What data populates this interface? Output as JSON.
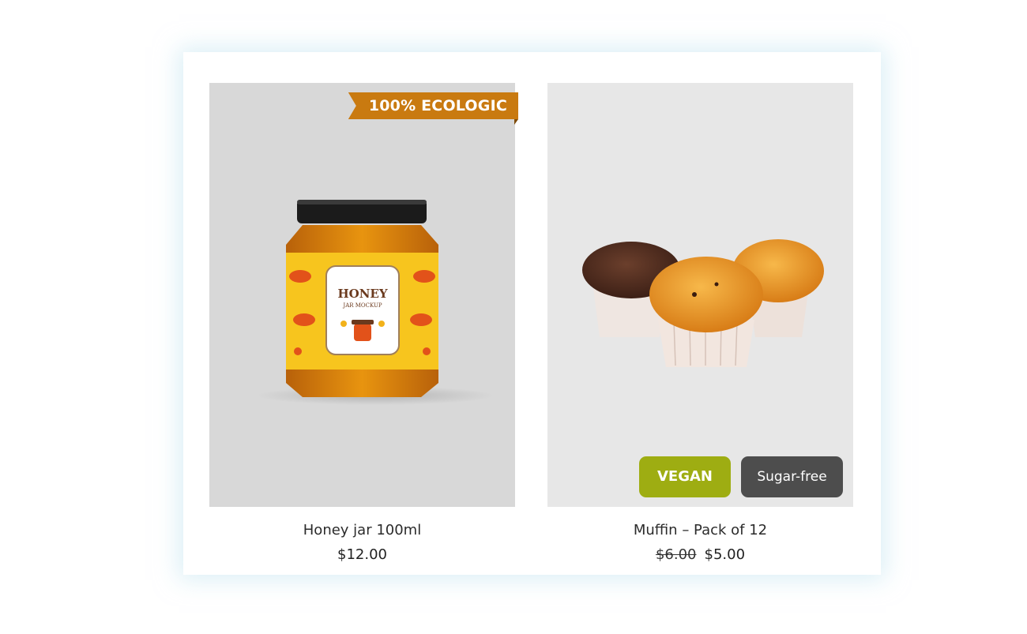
{
  "products": [
    {
      "title": "Honey jar 100ml",
      "price": "$12.00",
      "badge": "100% ECOLOGIC",
      "label": {
        "brand": "HONEY",
        "sub": "JAR MOCKUP"
      }
    },
    {
      "title": "Muffin – Pack of 12",
      "old_price": "$6.00",
      "price": "$5.00",
      "tags": [
        "VEGAN",
        "Sugar-free"
      ]
    }
  ],
  "colors": {
    "badge": "#c97a10",
    "vegan": "#9ead12",
    "sugar_free": "#4d4d4d"
  }
}
